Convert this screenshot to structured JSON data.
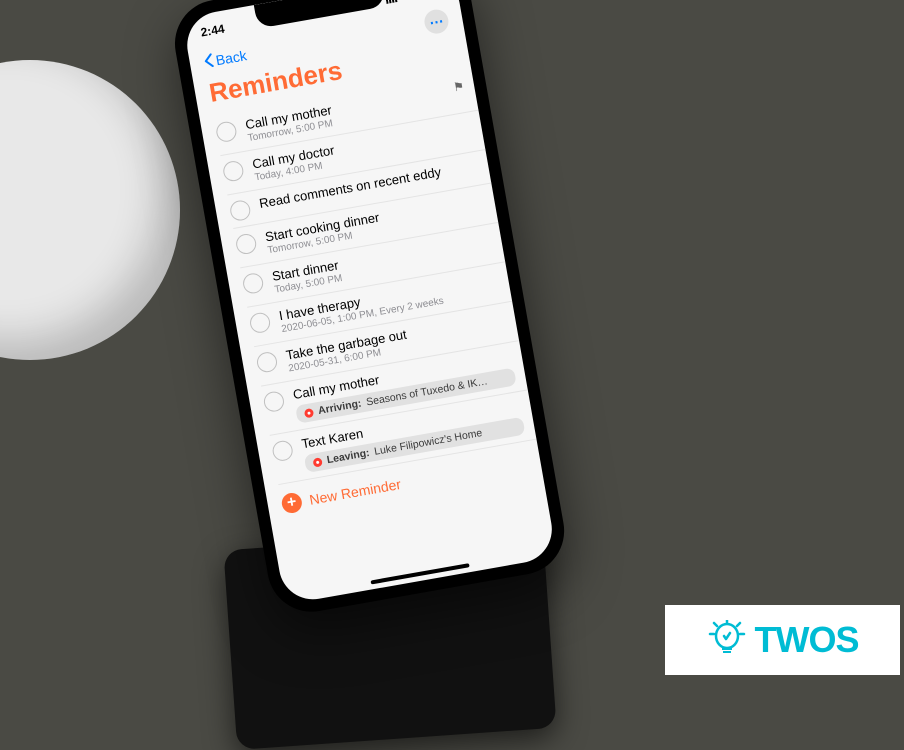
{
  "statusbar": {
    "time": "2:44"
  },
  "nav": {
    "back_label": "Back"
  },
  "title": "Reminders",
  "reminders": [
    {
      "title": "Call my mother",
      "sub": "Tomorrow, 5:00 PM",
      "flag": true
    },
    {
      "title": "Call my doctor",
      "sub": "Today, 4:00 PM"
    },
    {
      "title": "Read comments on recent eddy",
      "sub": ""
    },
    {
      "title": "Start cooking dinner",
      "sub": "Tomorrow, 5:00 PM"
    },
    {
      "title": "Start dinner",
      "sub": "Today, 5:00 PM"
    },
    {
      "title": "I have therapy",
      "sub": "2020-06-05, 1:00 PM, Every 2 weeks"
    },
    {
      "title": "Take the garbage out",
      "sub": "2020-05-31, 6:00 PM"
    },
    {
      "title": "Call my mother",
      "pill": {
        "kind": "Arriving",
        "place": "Seasons of Tuxedo & IK…"
      }
    },
    {
      "title": "Text Karen",
      "pill": {
        "kind": "Leaving",
        "place": "Luke Filipowicz's Home"
      }
    }
  ],
  "new_reminder_label": "New Reminder",
  "logo_text": "TWOS"
}
